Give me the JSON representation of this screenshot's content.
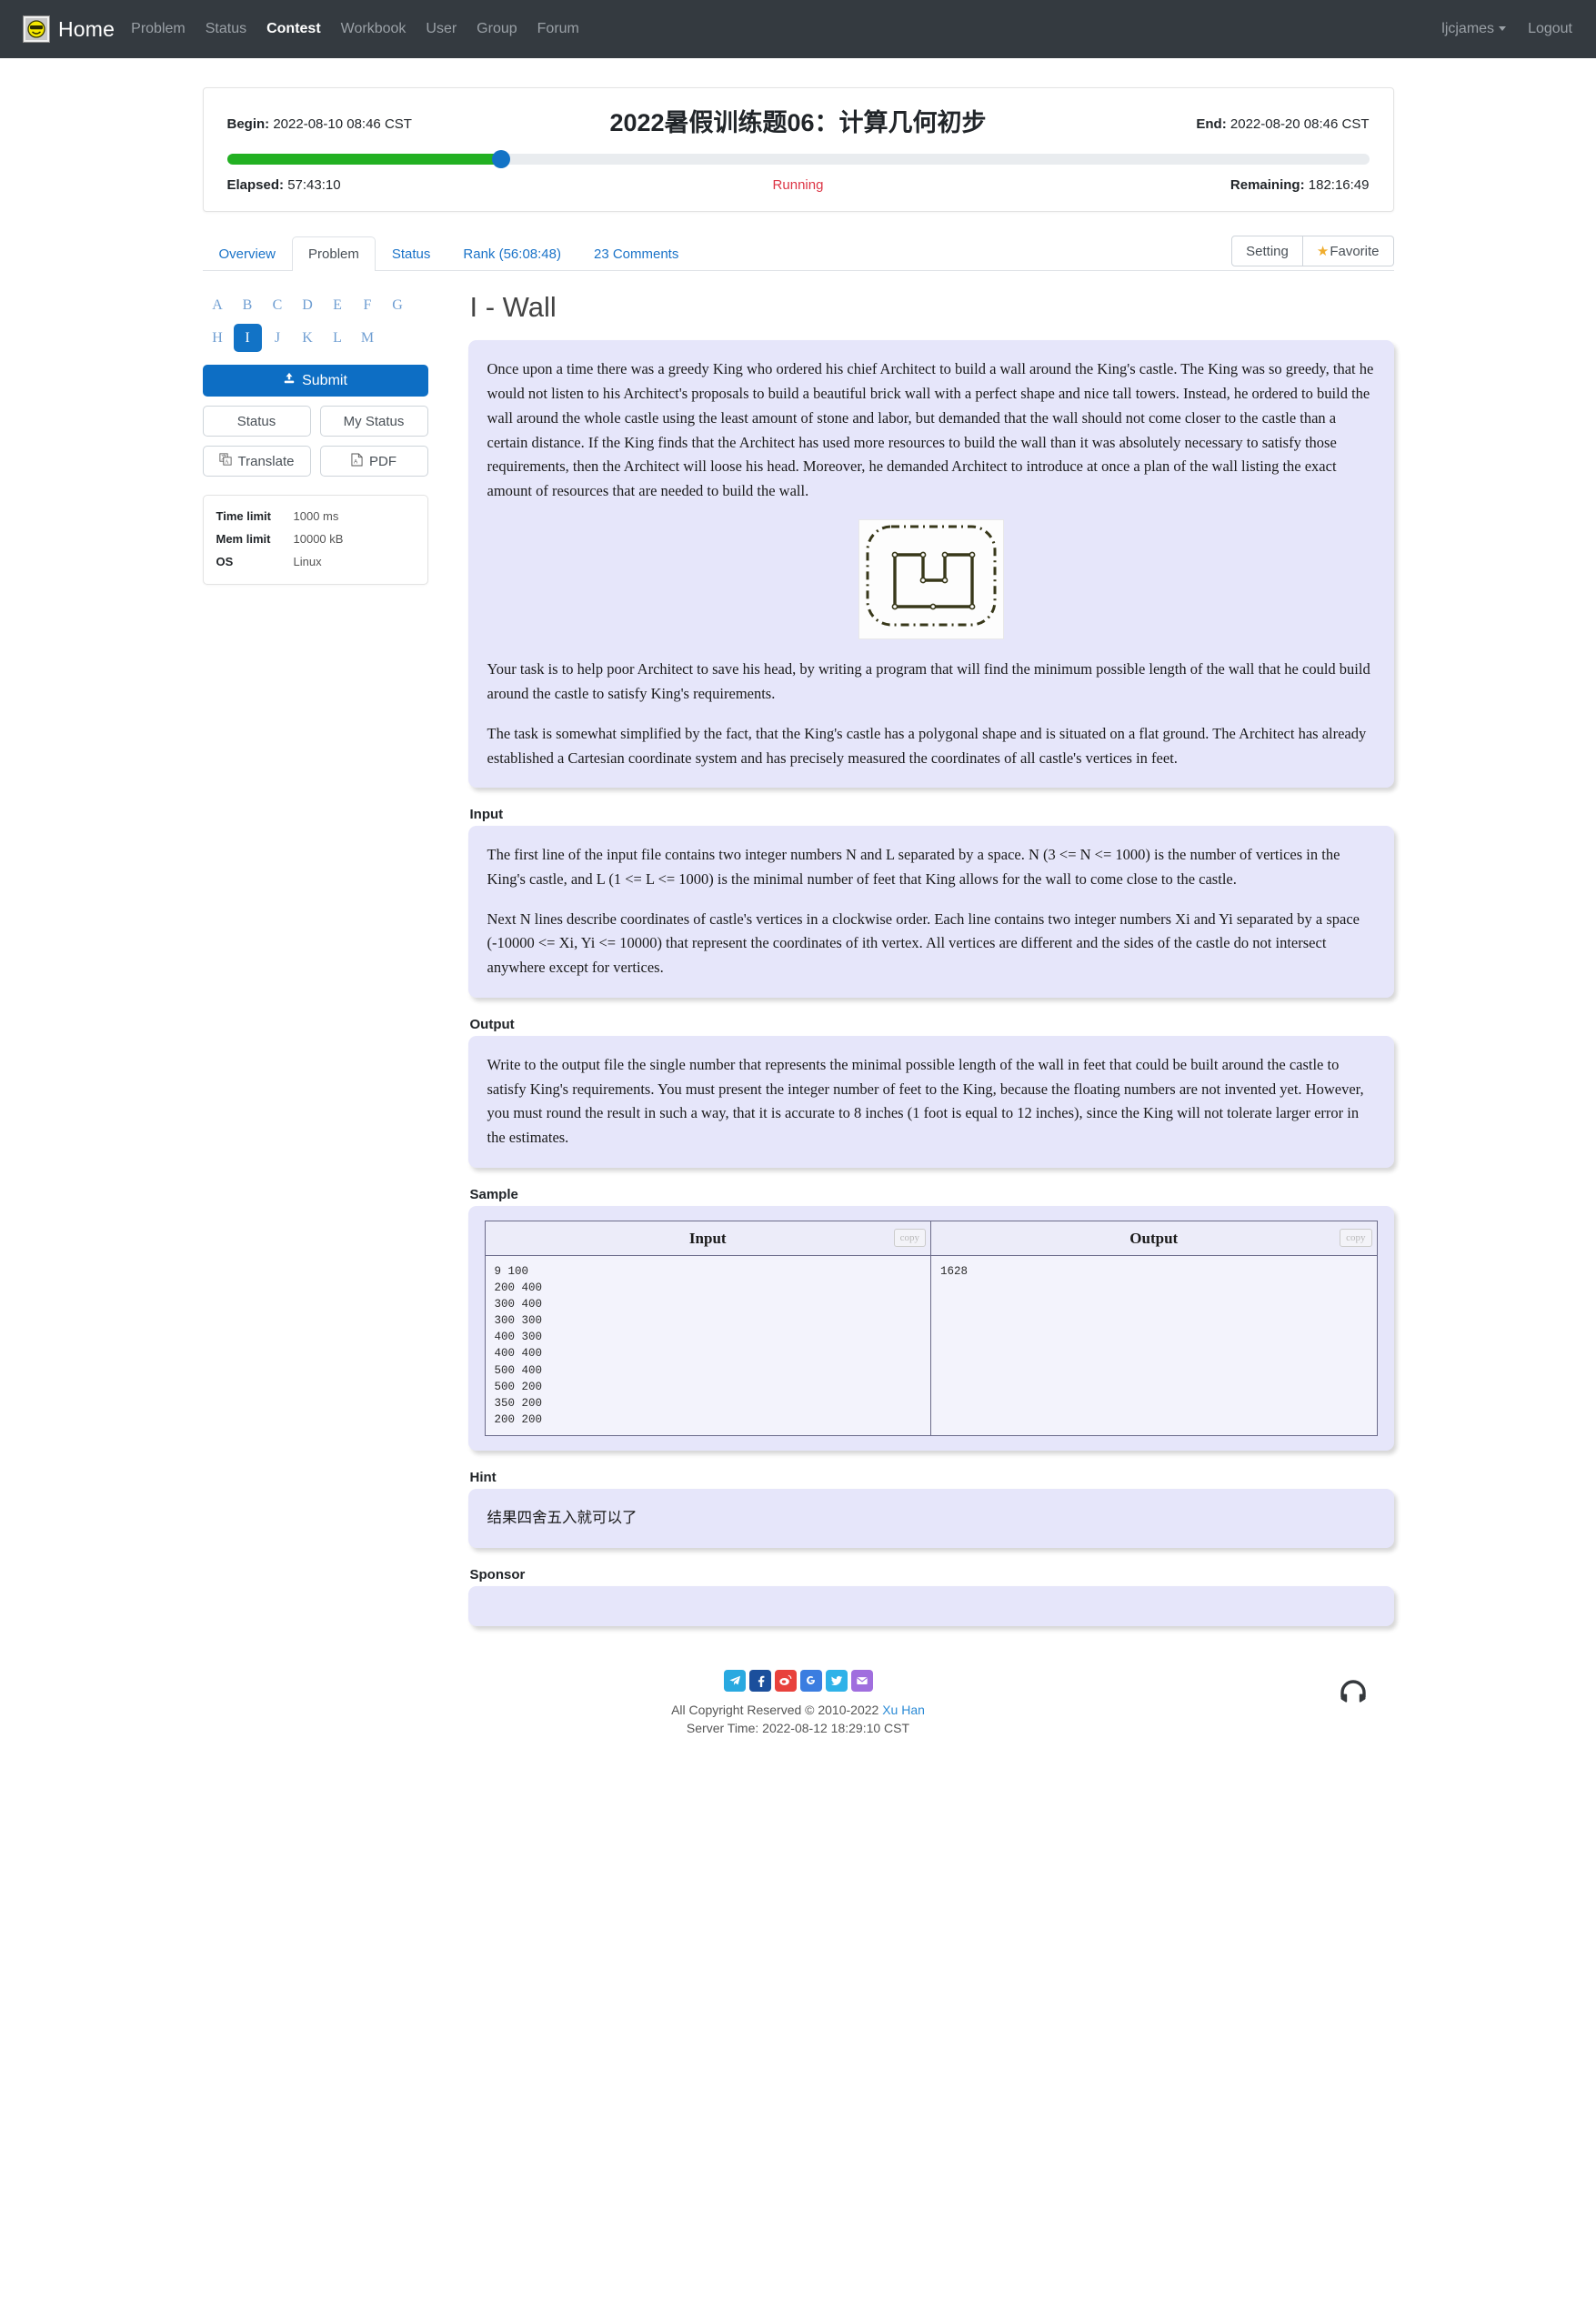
{
  "navbar": {
    "logo_icon": "smiley-sunglasses-logo",
    "brand": "Home",
    "links": [
      {
        "label": "Problem",
        "active": false
      },
      {
        "label": "Status",
        "active": false
      },
      {
        "label": "Contest",
        "active": true
      },
      {
        "label": "Workbook",
        "active": false
      },
      {
        "label": "User",
        "active": false
      },
      {
        "label": "Group",
        "active": false
      },
      {
        "label": "Forum",
        "active": false
      }
    ],
    "username": "ljcjames",
    "logout": "Logout"
  },
  "contest": {
    "begin_label": "Begin:",
    "begin_value": "2022-08-10 08:46 CST",
    "title": "2022暑假训练题06：计算几何初步",
    "end_label": "End:",
    "end_value": "2022-08-20 08:46 CST",
    "elapsed_label": "Elapsed:",
    "elapsed_value": "57:43:10",
    "status": "Running",
    "remaining_label": "Remaining:",
    "remaining_value": "182:16:49",
    "progress_percent": 24,
    "progress_color": "#22b022",
    "knob_color": "#1273c6"
  },
  "tabs": [
    {
      "label": "Overview",
      "active": false
    },
    {
      "label": "Problem",
      "active": true
    },
    {
      "label": "Status",
      "active": false
    },
    {
      "label": "Rank (56:08:48)",
      "active": false
    },
    {
      "label": "23 Comments",
      "active": false
    }
  ],
  "tab_actions": {
    "setting": "Setting",
    "favorite": "Favorite",
    "favorite_icon": "star-icon"
  },
  "sidebar": {
    "letters": [
      "A",
      "B",
      "C",
      "D",
      "E",
      "F",
      "G",
      "H",
      "I",
      "J",
      "K",
      "L",
      "M"
    ],
    "current_letter": "I",
    "submit": "Submit",
    "submit_icon": "upload-icon",
    "status": "Status",
    "my_status": "My Status",
    "translate": "Translate",
    "translate_icon": "translate-icon",
    "pdf": "PDF",
    "pdf_icon": "pdf-file-icon",
    "info": [
      {
        "key": "Time limit",
        "value": "1000 ms"
      },
      {
        "key": "Mem limit",
        "value": "10000 kB"
      },
      {
        "key": "OS",
        "value": "Linux"
      }
    ]
  },
  "problem": {
    "title": "I - Wall",
    "description_p1": "Once upon a time there was a greedy King who ordered his chief Architect to build a wall around the King's castle. The King was so greedy, that he would not listen to his Architect's proposals to build a beautiful brick wall with a perfect shape and nice tall towers. Instead, he ordered to build the wall around the whole castle using the least amount of stone and labor, but demanded that the wall should not come closer to the castle than a certain distance. If the King finds that the Architect has used more resources to build the wall than it was absolutely necessary to satisfy those requirements, then the Architect will loose his head. Moreover, he demanded Architect to introduce at once a plan of the wall listing the exact amount of resources that are needed to build the wall.",
    "figure_alt": "castle-wall-diagram",
    "description_p2": "Your task is to help poor Architect to save his head, by writing a program that will find the minimum possible length of the wall that he could build around the castle to satisfy King's requirements.",
    "description_p3": "The task is somewhat simplified by the fact, that the King's castle has a polygonal shape and is situated on a flat ground. The Architect has already established a Cartesian coordinate system and has precisely measured the coordinates of all castle's vertices in feet.",
    "input_label": "Input",
    "input_p1": "The first line of the input file contains two integer numbers N and L separated by a space. N (3 <= N <= 1000) is the number of vertices in the King's castle, and L (1 <= L <= 1000) is the minimal number of feet that King allows for the wall to come close to the castle.",
    "input_p2": "Next N lines describe coordinates of castle's vertices in a clockwise order. Each line contains two integer numbers Xi and Yi separated by a space (-10000 <= Xi, Yi <= 10000) that represent the coordinates of ith vertex. All vertices are different and the sides of the castle do not intersect anywhere except for vertices.",
    "output_label": "Output",
    "output_p1": "Write to the output file the single number that represents the minimal possible length of the wall in feet that could be built around the castle to satisfy King's requirements. You must present the integer number of feet to the King, because the floating numbers are not invented yet. However, you must round the result in such a way, that it is accurate to 8 inches (1 foot is equal to 12 inches), since the King will not tolerate larger error in the estimates.",
    "sample_label": "Sample",
    "sample_input_header": "Input",
    "sample_output_header": "Output",
    "copy_label": "copy",
    "sample_input": "9 100\n200 400\n300 400\n300 300\n400 300\n400 400\n500 400\n500 200\n350 200\n200 200",
    "sample_output": "1628",
    "hint_label": "Hint",
    "hint_text": "结果四舍五入就可以了",
    "sponsor_label": "Sponsor",
    "sponsor_text": ""
  },
  "footer": {
    "social": [
      {
        "name": "telegram-icon",
        "glyph": "➤",
        "color": "#29a9e0"
      },
      {
        "name": "facebook-icon",
        "glyph": "f",
        "color": "#1b4f9c"
      },
      {
        "name": "weibo-icon",
        "glyph": "ɕ",
        "color": "#e8413c"
      },
      {
        "name": "google-icon",
        "glyph": "G",
        "color": "#3b7de0"
      },
      {
        "name": "twitter-icon",
        "glyph": "🐦",
        "color": "#2fb2e8"
      },
      {
        "name": "email-icon",
        "glyph": "✉",
        "color": "#a06ede"
      }
    ],
    "copyright_prefix": "All Copyright Reserved © 2010-2022 ",
    "copyright_author": "Xu Han",
    "server_time": "Server Time: 2022-08-12 18:29:10 CST",
    "support_icon": "headphones-icon"
  }
}
